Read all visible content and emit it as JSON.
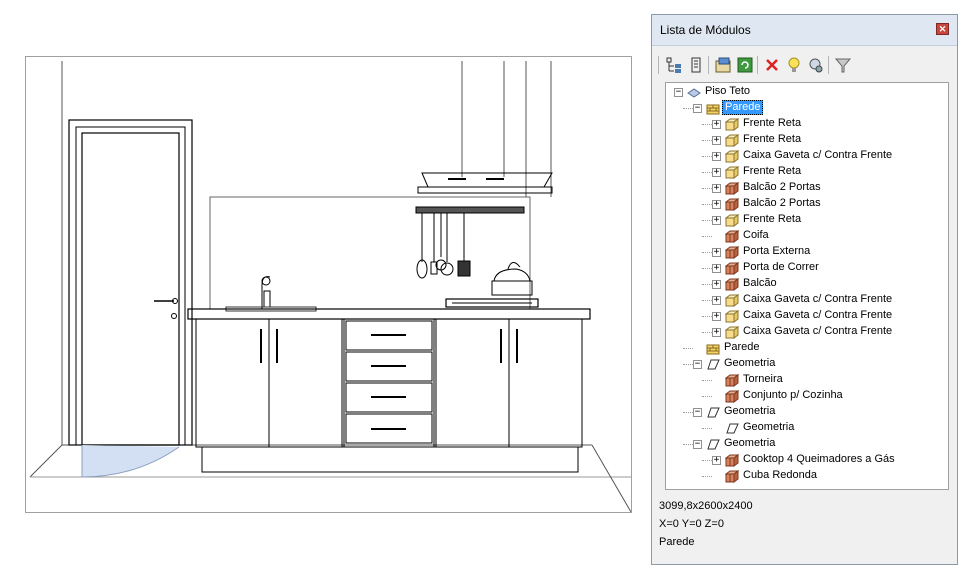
{
  "panel": {
    "title": "Lista de Módulos",
    "close_symbol": "✕",
    "toolbar": [
      {
        "name": "expand-tree-icon"
      },
      {
        "name": "collapse-tree-icon"
      },
      {
        "name": "properties-icon"
      },
      {
        "name": "refresh-icon"
      },
      {
        "name": "delete-icon"
      },
      {
        "name": "light-bulb-icon"
      },
      {
        "name": "hide-icon"
      },
      {
        "name": "filter-icon"
      }
    ]
  },
  "tree": [
    {
      "label": "Piso Teto",
      "level": 0,
      "expander": "minus",
      "icon": "floor"
    },
    {
      "label": "Parede",
      "level": 1,
      "expander": "minus",
      "icon": "wall",
      "selected": true
    },
    {
      "label": "Frente Reta",
      "level": 2,
      "expander": "plus",
      "icon": "front"
    },
    {
      "label": "Frente Reta",
      "level": 2,
      "expander": "plus",
      "icon": "front"
    },
    {
      "label": "Caixa Gaveta c/ Contra Frente",
      "level": 2,
      "expander": "plus",
      "icon": "front"
    },
    {
      "label": "Frente Reta",
      "level": 2,
      "expander": "plus",
      "icon": "front"
    },
    {
      "label": "Balcão 2 Portas",
      "level": 2,
      "expander": "plus",
      "icon": "box"
    },
    {
      "label": "Balcão 2 Portas",
      "level": 2,
      "expander": "plus",
      "icon": "box"
    },
    {
      "label": "Frente Reta",
      "level": 2,
      "expander": "plus",
      "icon": "front"
    },
    {
      "label": "Coifa",
      "level": 2,
      "expander": "none",
      "icon": "box"
    },
    {
      "label": "Porta Externa",
      "level": 2,
      "expander": "plus",
      "icon": "box"
    },
    {
      "label": "Porta de Correr",
      "level": 2,
      "expander": "plus",
      "icon": "box"
    },
    {
      "label": "Balcão",
      "level": 2,
      "expander": "plus",
      "icon": "box"
    },
    {
      "label": "Caixa Gaveta c/ Contra Frente",
      "level": 2,
      "expander": "plus",
      "icon": "front"
    },
    {
      "label": "Caixa Gaveta c/ Contra Frente",
      "level": 2,
      "expander": "plus",
      "icon": "front"
    },
    {
      "label": "Caixa Gaveta c/ Contra Frente",
      "level": 2,
      "expander": "plus",
      "icon": "front"
    },
    {
      "label": "Parede",
      "level": 1,
      "expander": "none",
      "icon": "wall"
    },
    {
      "label": "Geometria",
      "level": 1,
      "expander": "minus",
      "icon": "geometry"
    },
    {
      "label": "Torneira",
      "level": 2,
      "expander": "none",
      "icon": "box"
    },
    {
      "label": "Conjunto p/ Cozinha",
      "level": 2,
      "expander": "none",
      "icon": "box"
    },
    {
      "label": "Geometria",
      "level": 1,
      "expander": "minus",
      "icon": "geometry"
    },
    {
      "label": "Geometria",
      "level": 2,
      "expander": "none",
      "icon": "geometry"
    },
    {
      "label": "Geometria",
      "level": 1,
      "expander": "minus",
      "icon": "geometry"
    },
    {
      "label": "Cooktop 4 Queimadores a Gás",
      "level": 2,
      "expander": "plus",
      "icon": "box"
    },
    {
      "label": "Cuba Redonda",
      "level": 2,
      "expander": "none",
      "icon": "box"
    }
  ],
  "status": {
    "dimensions": "3099,8x2600x2400",
    "coordinates": "X=0  Y=0  Z=0",
    "selection": "Parede"
  }
}
